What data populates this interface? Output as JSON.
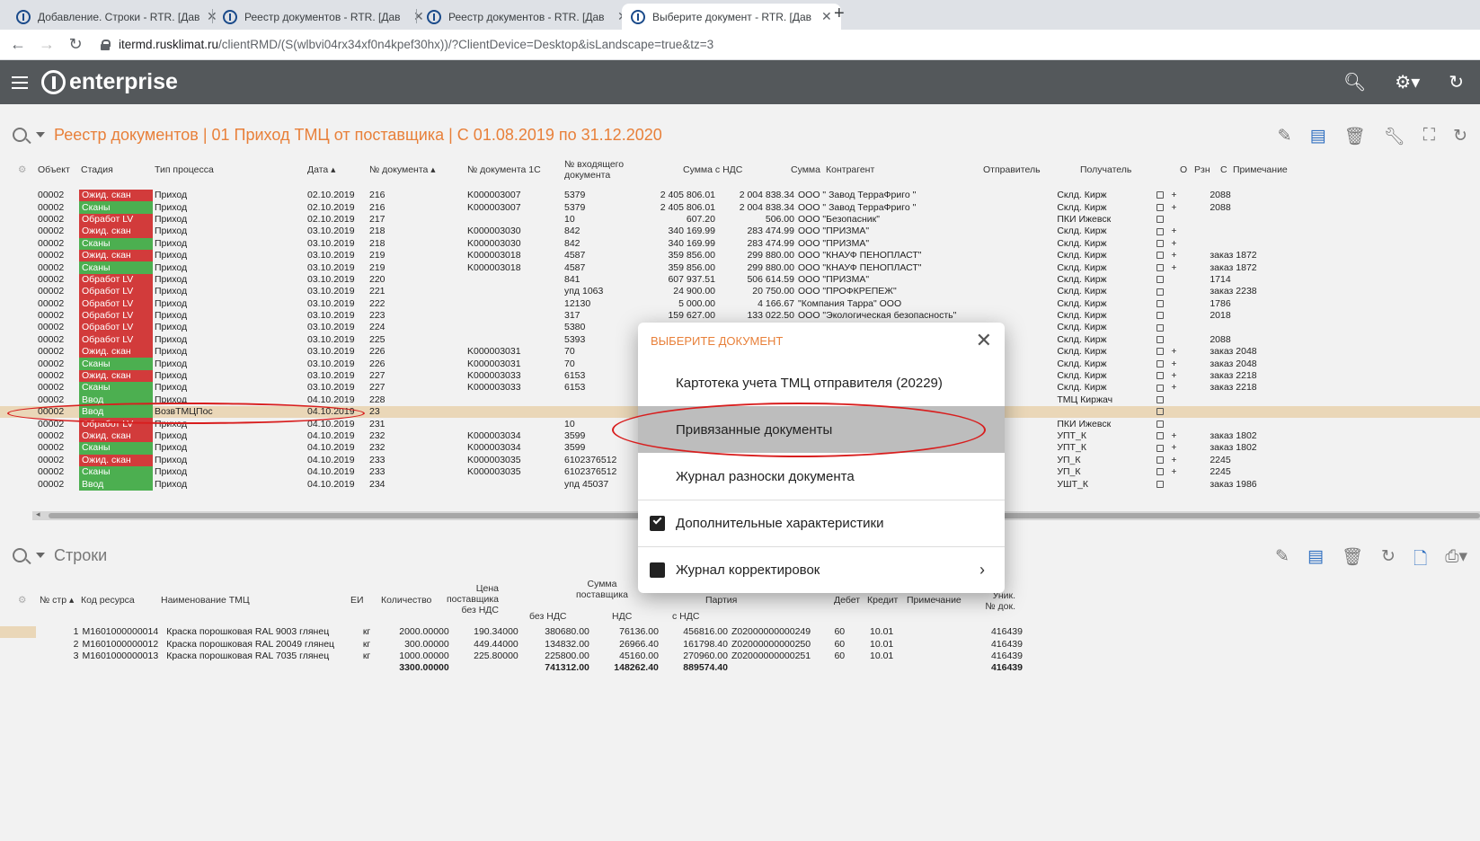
{
  "tabs": [
    {
      "title": "Добавление. Строки - RTR. [Дав",
      "active": false
    },
    {
      "title": "Реестр документов - RTR. [Дав",
      "active": false
    },
    {
      "title": "Реестр документов - RTR. [Дав",
      "active": false
    },
    {
      "title": "Выберите документ - RTR. [Дав",
      "active": true
    }
  ],
  "address": {
    "host": "itermd.rusklimat.ru",
    "path": "/clientRMD/(S(wlbvi04rx34xf0n4kpef30hx))/?ClientDevice=Desktop&isLandscape=true&tz=3"
  },
  "app": {
    "logo": "enterprise"
  },
  "registry": {
    "title": "Реестр документов | 01 Приход ТМЦ от поставщика | С 01.08.2019 по 31.12.2020",
    "columns": {
      "obj": "Объект",
      "stage": "Стадия",
      "ptype": "Тип процесса",
      "date": "Дата",
      "docno": "№ документа",
      "doc1c": "№ документа 1С",
      "incoming": "№ входящего документа",
      "sumvat": "Сумма с НДС",
      "sum": "Сумма",
      "contractor": "Контрагент",
      "sender": "Отправитель",
      "receiver": "Получатель",
      "o": "О",
      "rzn": "Рзн",
      "c": "С",
      "note": "Примечание"
    },
    "rows": [
      {
        "obj": "00002",
        "stage": "Ожид. скан",
        "color": "red",
        "ptype": "Приход",
        "date": "02.10.2019",
        "docno": "216",
        "doc1c": "K000003007",
        "inc": "5379",
        "sumvat": "2 405 806.01",
        "sum": "2 004 838.34",
        "contr": "ООО \" Завод ТерраФриго \"",
        "recv": "Склд. Кирж",
        "rzn": "+",
        "note": "2088"
      },
      {
        "obj": "00002",
        "stage": "Сканы",
        "color": "green",
        "ptype": "Приход",
        "date": "02.10.2019",
        "docno": "216",
        "doc1c": "K000003007",
        "inc": "5379",
        "sumvat": "2 405 806.01",
        "sum": "2 004 838.34",
        "contr": "ООО \" Завод ТерраФриго \"",
        "recv": "Склд. Кирж",
        "rzn": "+",
        "note": "2088"
      },
      {
        "obj": "00002",
        "stage": "Обработ LV",
        "color": "red",
        "ptype": "Приход",
        "date": "02.10.2019",
        "docno": "217",
        "doc1c": "",
        "inc": "10",
        "sumvat": "607.20",
        "sum": "506.00",
        "contr": "ООО \"Безопасник\"",
        "recv": "ПКИ Ижевск",
        "rzn": "",
        "note": ""
      },
      {
        "obj": "00002",
        "stage": "Ожид. скан",
        "color": "red",
        "ptype": "Приход",
        "date": "03.10.2019",
        "docno": "218",
        "doc1c": "K000003030",
        "inc": "842",
        "sumvat": "340 169.99",
        "sum": "283 474.99",
        "contr": "ООО \"ПРИЗМА\"",
        "recv": "Склд. Кирж",
        "rzn": "+",
        "note": ""
      },
      {
        "obj": "00002",
        "stage": "Сканы",
        "color": "green",
        "ptype": "Приход",
        "date": "03.10.2019",
        "docno": "218",
        "doc1c": "K000003030",
        "inc": "842",
        "sumvat": "340 169.99",
        "sum": "283 474.99",
        "contr": "ООО \"ПРИЗМА\"",
        "recv": "Склд. Кирж",
        "rzn": "+",
        "note": ""
      },
      {
        "obj": "00002",
        "stage": "Ожид. скан",
        "color": "red",
        "ptype": "Приход",
        "date": "03.10.2019",
        "docno": "219",
        "doc1c": "K000003018",
        "inc": "4587",
        "sumvat": "359 856.00",
        "sum": "299 880.00",
        "contr": "ООО \"КНАУФ ПЕНОПЛАСТ\"",
        "recv": "Склд. Кирж",
        "rzn": "+",
        "note": "заказ 1872"
      },
      {
        "obj": "00002",
        "stage": "Сканы",
        "color": "green",
        "ptype": "Приход",
        "date": "03.10.2019",
        "docno": "219",
        "doc1c": "K000003018",
        "inc": "4587",
        "sumvat": "359 856.00",
        "sum": "299 880.00",
        "contr": "ООО \"КНАУФ ПЕНОПЛАСТ\"",
        "recv": "Склд. Кирж",
        "rzn": "+",
        "note": "заказ 1872"
      },
      {
        "obj": "00002",
        "stage": "Обработ LV",
        "color": "red",
        "ptype": "Приход",
        "date": "03.10.2019",
        "docno": "220",
        "doc1c": "",
        "inc": "841",
        "sumvat": "607 937.51",
        "sum": "506 614.59",
        "contr": "ООО \"ПРИЗМА\"",
        "recv": "Склд. Кирж",
        "rzn": "",
        "note": "1714"
      },
      {
        "obj": "00002",
        "stage": "Обработ LV",
        "color": "red",
        "ptype": "Приход",
        "date": "03.10.2019",
        "docno": "221",
        "doc1c": "",
        "inc": "упд 1063",
        "sumvat": "24 900.00",
        "sum": "20 750.00",
        "contr": "ООО \"ПРОФКРЕПЕЖ\"",
        "recv": "Склд. Кирж",
        "rzn": "",
        "note": "заказ 2238"
      },
      {
        "obj": "00002",
        "stage": "Обработ LV",
        "color": "red",
        "ptype": "Приход",
        "date": "03.10.2019",
        "docno": "222",
        "doc1c": "",
        "inc": "12130",
        "sumvat": "5 000.00",
        "sum": "4 166.67",
        "contr": "\"Компания Тарра\" ООО",
        "recv": "Склд. Кирж",
        "rzn": "",
        "note": "1786"
      },
      {
        "obj": "00002",
        "stage": "Обработ LV",
        "color": "red",
        "ptype": "Приход",
        "date": "03.10.2019",
        "docno": "223",
        "doc1c": "",
        "inc": "317",
        "sumvat": "159 627.00",
        "sum": "133 022.50",
        "contr": "ООО \"Экологическая безопасность\"",
        "recv": "Склд. Кирж",
        "rzn": "",
        "note": "2018"
      },
      {
        "obj": "00002",
        "stage": "Обработ LV",
        "color": "red",
        "ptype": "Приход",
        "date": "03.10.2019",
        "docno": "224",
        "doc1c": "",
        "inc": "5380",
        "sumvat": "",
        "sum": "",
        "contr": "",
        "recv": "Склд. Кирж",
        "rzn": "",
        "note": ""
      },
      {
        "obj": "00002",
        "stage": "Обработ LV",
        "color": "red",
        "ptype": "Приход",
        "date": "03.10.2019",
        "docno": "225",
        "doc1c": "",
        "inc": "5393",
        "sumvat": "",
        "sum": "",
        "contr": "",
        "recv": "Склд. Кирж",
        "rzn": "",
        "note": "2088"
      },
      {
        "obj": "00002",
        "stage": "Ожид. скан",
        "color": "red",
        "ptype": "Приход",
        "date": "03.10.2019",
        "docno": "226",
        "doc1c": "K000003031",
        "inc": "70",
        "sumvat": "",
        "sum": "",
        "contr": "",
        "recv": "Склд. Кирж",
        "rzn": "+",
        "note": "заказ 2048"
      },
      {
        "obj": "00002",
        "stage": "Сканы",
        "color": "green",
        "ptype": "Приход",
        "date": "03.10.2019",
        "docno": "226",
        "doc1c": "K000003031",
        "inc": "70",
        "sumvat": "",
        "sum": "",
        "contr": "",
        "recv": "Склд. Кирж",
        "rzn": "+",
        "note": "заказ 2048"
      },
      {
        "obj": "00002",
        "stage": "Ожид. скан",
        "color": "red",
        "ptype": "Приход",
        "date": "03.10.2019",
        "docno": "227",
        "doc1c": "K000003033",
        "inc": "6153",
        "sumvat": "",
        "sum": "",
        "contr": "",
        "recv": "Склд. Кирж",
        "rzn": "+",
        "note": "заказ 2218"
      },
      {
        "obj": "00002",
        "stage": "Сканы",
        "color": "green",
        "ptype": "Приход",
        "date": "03.10.2019",
        "docno": "227",
        "doc1c": "K000003033",
        "inc": "6153",
        "sumvat": "",
        "sum": "",
        "contr": "",
        "recv": "Склд. Кирж",
        "rzn": "+",
        "note": "заказ 2218"
      },
      {
        "obj": "00002",
        "stage": "Ввод",
        "color": "green",
        "ptype": "Приход",
        "date": "04.10.2019",
        "docno": "228",
        "doc1c": "",
        "inc": "",
        "sumvat": "",
        "sum": "",
        "contr": "",
        "recv": "ТМЦ Киржач",
        "rzn": "",
        "note": ""
      },
      {
        "obj": "00002",
        "stage": "Ввод",
        "color": "green",
        "ptype": "ВозвТМЦПос",
        "date": "04.10.2019",
        "docno": "23",
        "doc1c": "",
        "inc": "",
        "sumvat": "",
        "sum": "",
        "contr": "",
        "recv": "",
        "rzn": "",
        "note": "",
        "selected": true
      },
      {
        "obj": "00002",
        "stage": "Обработ LV",
        "color": "red",
        "ptype": "Приход",
        "date": "04.10.2019",
        "docno": "231",
        "doc1c": "",
        "inc": "10",
        "sumvat": "",
        "sum": "",
        "contr": "",
        "recv": "ПКИ Ижевск",
        "rzn": "",
        "note": ""
      },
      {
        "obj": "00002",
        "stage": "Ожид. скан",
        "color": "red",
        "ptype": "Приход",
        "date": "04.10.2019",
        "docno": "232",
        "doc1c": "K000003034",
        "inc": "3599",
        "sumvat": "",
        "sum": "",
        "contr": "",
        "recv": "УПТ_К",
        "rzn": "+",
        "note": "заказ 1802"
      },
      {
        "obj": "00002",
        "stage": "Сканы",
        "color": "green",
        "ptype": "Приход",
        "date": "04.10.2019",
        "docno": "232",
        "doc1c": "K000003034",
        "inc": "3599",
        "sumvat": "",
        "sum": "",
        "contr": "",
        "recv": "УПТ_К",
        "rzn": "+",
        "note": "заказ 1802"
      },
      {
        "obj": "00002",
        "stage": "Ожид. скан",
        "color": "red",
        "ptype": "Приход",
        "date": "04.10.2019",
        "docno": "233",
        "doc1c": "K000003035",
        "inc": "6102376512",
        "sumvat": "",
        "sum": "",
        "contr": "",
        "recv": "УП_К",
        "rzn": "+",
        "note": "2245"
      },
      {
        "obj": "00002",
        "stage": "Сканы",
        "color": "green",
        "ptype": "Приход",
        "date": "04.10.2019",
        "docno": "233",
        "doc1c": "K000003035",
        "inc": "6102376512",
        "sumvat": "",
        "sum": "",
        "contr": "",
        "recv": "УП_К",
        "rzn": "+",
        "note": "2245"
      },
      {
        "obj": "00002",
        "stage": "Ввод",
        "color": "green",
        "ptype": "Приход",
        "date": "04.10.2019",
        "docno": "234",
        "doc1c": "",
        "inc": "упд 45037",
        "sumvat": "",
        "sum": "",
        "contr": "",
        "recv": "УШТ_К",
        "rzn": "",
        "note": "заказ 1986"
      }
    ]
  },
  "lines": {
    "title": "Строки",
    "columns": {
      "no": "№ стр",
      "code": "Код ресурса",
      "name": "Наименование ТМЦ",
      "unit": "ЕИ",
      "qty": "Количество",
      "price": "Цена поставщика без НДС",
      "sumgroup": "Сумма поставщика",
      "novat": "без НДС",
      "vat": "НДС",
      "withvat": "с НДС",
      "batch": "Партия",
      "debit": "Дебет",
      "credit": "Кредит",
      "note": "Примечание",
      "uniq": "Уник. № док."
    },
    "rows": [
      {
        "no": "1",
        "code": "M1601000000014",
        "name": "Краска порошковая RAL 9003 глянец",
        "unit": "кг",
        "qty": "2000.00000",
        "price": "190.34000",
        "novat": "380680.00",
        "vat": "76136.00",
        "withvat": "456816.00",
        "batch": "Z02000000000249",
        "debit": "60",
        "credit": "10.01",
        "uniq": "416439"
      },
      {
        "no": "2",
        "code": "M1601000000012",
        "name": "Краска порошковая RAL 20049 глянец",
        "unit": "кг",
        "qty": "300.00000",
        "price": "449.44000",
        "novat": "134832.00",
        "vat": "26966.40",
        "withvat": "161798.40",
        "batch": "Z02000000000250",
        "debit": "60",
        "credit": "10.01",
        "uniq": "416439"
      },
      {
        "no": "3",
        "code": "M1601000000013",
        "name": "Краска порошковая RAL 7035 глянец",
        "unit": "кг",
        "qty": "1000.00000",
        "price": "225.80000",
        "novat": "225800.00",
        "vat": "45160.00",
        "withvat": "270960.00",
        "batch": "Z02000000000251",
        "debit": "60",
        "credit": "10.01",
        "uniq": "416439"
      }
    ],
    "totals": {
      "qty": "3300.00000",
      "novat": "741312.00",
      "vat": "148262.40",
      "withvat": "889574.40",
      "uniq": "416439"
    }
  },
  "modal": {
    "title": "ВЫБЕРИТЕ ДОКУМЕНТ",
    "items": [
      {
        "label": "Картотека учета ТМЦ отправителя (20229)"
      },
      {
        "label": "Привязанные документы"
      },
      {
        "label": "Журнал разноски документа"
      },
      {
        "label": "Дополнительные характеристики"
      },
      {
        "label": "Журнал корректировок"
      }
    ]
  },
  "colors": {
    "accent": "#e8803a",
    "header": "#54585b",
    "status_red": "#d23b3b",
    "status_green": "#4caf50",
    "highlight": "#d81e1e"
  }
}
